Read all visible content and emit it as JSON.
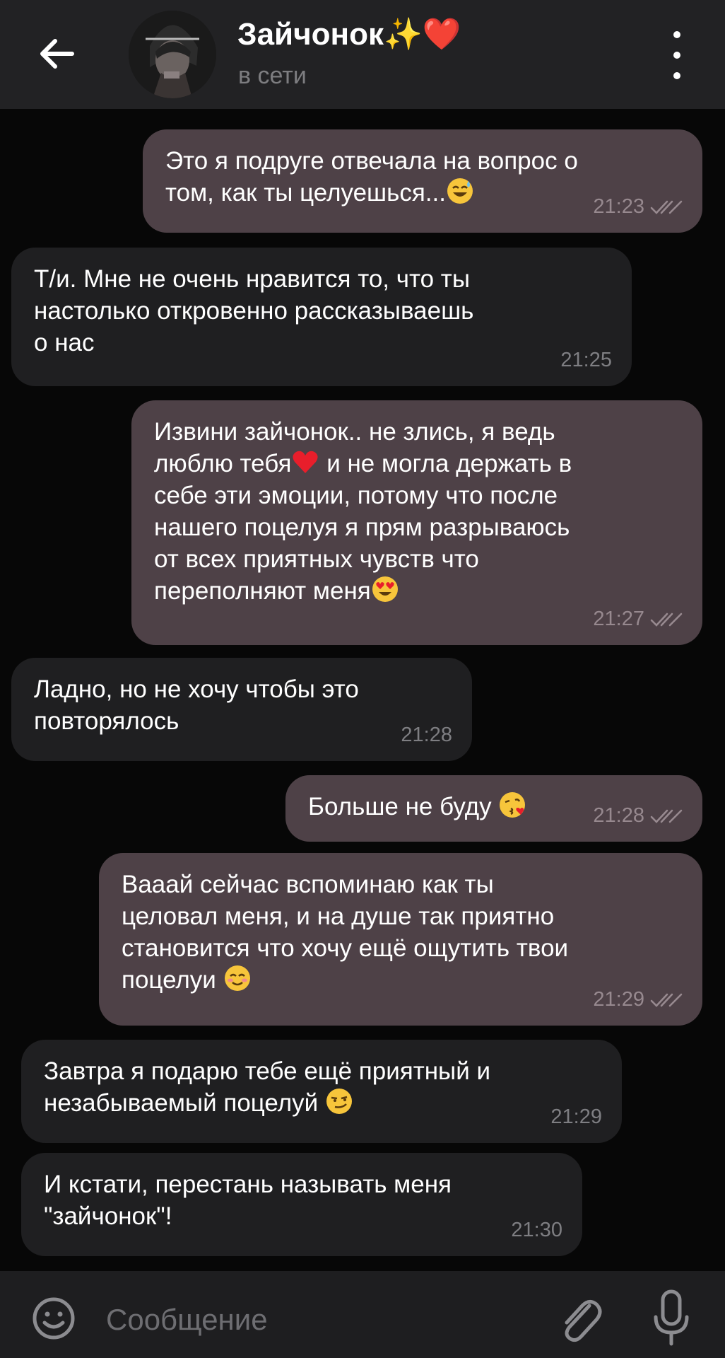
{
  "header": {
    "back_label": "←",
    "title": "Зайчонок✨❤️",
    "status": "в сети"
  },
  "messages": [
    {
      "dir": "out",
      "text": "Это я подруге отвечала на вопрос о\nтом, как ты целуешься...😅",
      "time": "21:23",
      "read": true
    },
    {
      "dir": "in",
      "text": "Т/и. Мне не очень нравится то, что ты\nнастолько откровенно рассказываешь\nо нас",
      "time": "21:25"
    },
    {
      "dir": "out",
      "text": "Извини зайчонок.. не злись, я ведь\nлюблю тебя❤️ и не могла держать в\nсебе эти эмоции, потому что после\nнашего поцелуя я прям разрываюсь\nот всех приятных чувств что\nпереполняют меня😍",
      "time": "21:27",
      "read": true
    },
    {
      "dir": "in",
      "text": "Ладно, но не хочу чтобы это\nповторялось",
      "time": "21:28"
    },
    {
      "dir": "out",
      "text": "Больше не буду 😘",
      "time": "21:28",
      "read": true
    },
    {
      "dir": "out",
      "text": "Вааай сейчас вспоминаю как ты\nцеловал меня, и на душе так приятно\nстановится что хочу ещё ощутить твои\nпоцелуи 😊",
      "time": "21:29",
      "read": true
    },
    {
      "dir": "in",
      "text": "Завтра я подарю тебе ещё приятный и\nнезабываемый поцелуй 😏",
      "time": "21:29"
    },
    {
      "dir": "in",
      "text": "И кстати, перестань называть меня\n\"зайчонок\"!",
      "time": "21:30"
    }
  ],
  "composer": {
    "placeholder": "Сообщение"
  },
  "icons": {
    "back": "arrow-left-icon",
    "menu": "more-vert-icon",
    "emoji": "smiley-icon",
    "attach": "paperclip-icon",
    "mic": "microphone-icon",
    "ticks": "double-check-icon"
  },
  "colors": {
    "background": "#070707",
    "header": "#222224",
    "outgoing_bubble": "#4e4147",
    "incoming_bubble": "#1f1f21"
  }
}
